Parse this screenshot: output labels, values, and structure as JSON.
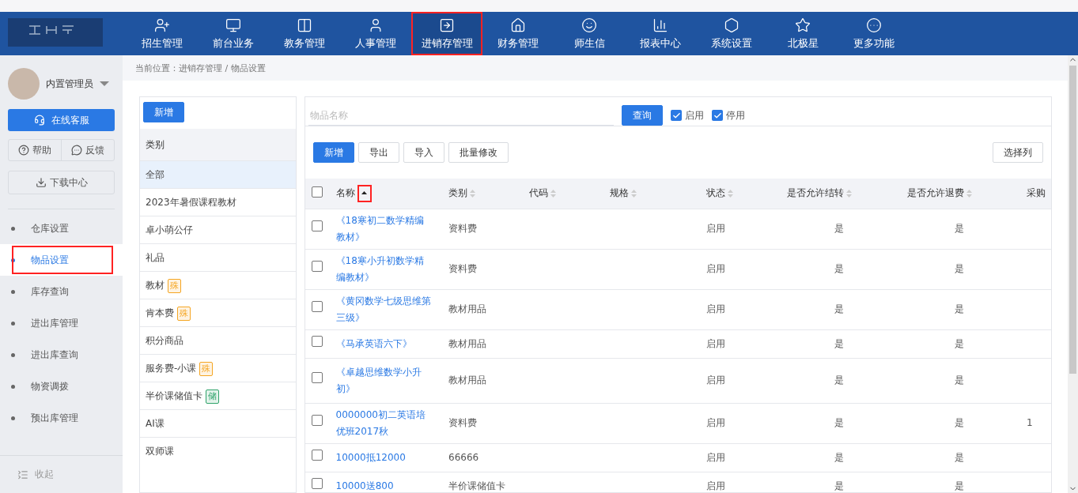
{
  "nav": {
    "items": [
      {
        "label": "招生管理",
        "selected": false,
        "highlighted": false
      },
      {
        "label": "前台业务",
        "selected": false,
        "highlighted": false
      },
      {
        "label": "教务管理",
        "selected": false,
        "highlighted": false
      },
      {
        "label": "人事管理",
        "selected": false,
        "highlighted": false
      },
      {
        "label": "进销存管理",
        "selected": true,
        "highlighted": true
      },
      {
        "label": "财务管理",
        "selected": false,
        "highlighted": false
      },
      {
        "label": "师生信",
        "selected": false,
        "highlighted": false
      },
      {
        "label": "报表中心",
        "selected": false,
        "highlighted": false
      },
      {
        "label": "系统设置",
        "selected": false,
        "highlighted": false
      },
      {
        "label": "北极星",
        "selected": false,
        "highlighted": false
      },
      {
        "label": "更多功能",
        "selected": false,
        "highlighted": false
      }
    ]
  },
  "sidebar": {
    "user": "内置管理员",
    "service_button": "在线客服",
    "help": "帮助",
    "feedback": "反馈",
    "download": "下载中心",
    "menu": [
      {
        "label": "仓库设置",
        "selected": false,
        "highlighted": false
      },
      {
        "label": "物品设置",
        "selected": true,
        "highlighted": true
      },
      {
        "label": "库存查询",
        "selected": false,
        "highlighted": false
      },
      {
        "label": "进出库管理",
        "selected": false,
        "highlighted": false
      },
      {
        "label": "进出库查询",
        "selected": false,
        "highlighted": false
      },
      {
        "label": "物资调拨",
        "selected": false,
        "highlighted": false
      },
      {
        "label": "预出库管理",
        "selected": false,
        "highlighted": false
      }
    ],
    "collapse": "收起"
  },
  "breadcrumb": "当前位置：进销存管理 / 物品设置",
  "categories": {
    "add_button": "新增",
    "header": "类别",
    "items": [
      {
        "label": "全部",
        "selected": true
      },
      {
        "label": "2023年暑假课程教材",
        "selected": false
      },
      {
        "label": "卓小萌公仔",
        "selected": false
      },
      {
        "label": "礼品",
        "selected": false
      },
      {
        "label": "教材",
        "selected": false,
        "tag": {
          "text": "殊",
          "color": "#f5a623"
        }
      },
      {
        "label": "肯本费",
        "selected": false,
        "tag": {
          "text": "殊",
          "color": "#f5a623"
        }
      },
      {
        "label": "积分商品",
        "selected": false
      },
      {
        "label": "服务费-小课",
        "selected": false,
        "tag": {
          "text": "殊",
          "color": "#f5a623"
        }
      },
      {
        "label": "半价课储值卡",
        "selected": false,
        "tag": {
          "text": "储",
          "color": "#2fa36b"
        }
      },
      {
        "label": "AI课",
        "selected": false
      },
      {
        "label": "双师课",
        "selected": false
      }
    ]
  },
  "filter": {
    "placeholder": "物品名称",
    "query_button": "查询",
    "options": [
      {
        "label": "启用",
        "checked": true
      },
      {
        "label": "停用",
        "checked": true
      }
    ]
  },
  "toolbar": {
    "buttons": [
      {
        "label": "新增",
        "primary": true
      },
      {
        "label": "导出",
        "primary": false
      },
      {
        "label": "导入",
        "primary": false
      },
      {
        "label": "批量修改",
        "primary": false
      }
    ],
    "columns_button": "选择列"
  },
  "table": {
    "all_checked": false,
    "columns": [
      {
        "label": "名称",
        "sortable": true,
        "sorted_ascending": true,
        "highlighted": true
      },
      {
        "label": "类别",
        "sortable": true,
        "sorted_ascending": false,
        "highlighted": false
      },
      {
        "label": "代码",
        "sortable": true,
        "sorted_ascending": false,
        "highlighted": false
      },
      {
        "label": "规格",
        "sortable": true,
        "sorted_ascending": false,
        "highlighted": false
      },
      {
        "label": "状态",
        "sortable": true,
        "sorted_ascending": false,
        "highlighted": false
      },
      {
        "label": "是否允许结转",
        "sortable": true,
        "sorted_ascending": false,
        "highlighted": false
      },
      {
        "label": "是否允许退费",
        "sortable": true,
        "sorted_ascending": false,
        "highlighted": false
      },
      {
        "label": "采购",
        "sortable": false,
        "highlighted": false
      }
    ],
    "rows": [
      {
        "checked": false,
        "cells": [
          "《18寒初二数学精编教材》",
          "资料费",
          "",
          "",
          "启用",
          "是",
          "是",
          ""
        ]
      },
      {
        "checked": false,
        "cells": [
          "《18寒小升初数学精编教材》",
          "资料费",
          "",
          "",
          "启用",
          "是",
          "是",
          ""
        ]
      },
      {
        "checked": false,
        "cells": [
          "《黄冈数学七级思维第三级》",
          "教材用品",
          "",
          "",
          "启用",
          "是",
          "是",
          ""
        ]
      },
      {
        "checked": false,
        "cells": [
          "《马承英语六下》",
          "教材用品",
          "",
          "",
          "启用",
          "是",
          "是",
          ""
        ]
      },
      {
        "checked": false,
        "cells": [
          "《卓越思维数学小升初》",
          "教材用品",
          "",
          "",
          "启用",
          "是",
          "是",
          ""
        ]
      },
      {
        "checked": false,
        "cells": [
          "0000000初二英语培优班2017秋",
          "资料费",
          "",
          "",
          "启用",
          "是",
          "是",
          "1"
        ]
      },
      {
        "checked": false,
        "cells": [
          "10000抵12000",
          "66666",
          "",
          "",
          "启用",
          "是",
          "是",
          ""
        ]
      },
      {
        "checked": false,
        "cells": [
          "10000送800",
          "半价课储值卡",
          "",
          "",
          "启用",
          "是",
          "是",
          ""
        ]
      }
    ]
  }
}
